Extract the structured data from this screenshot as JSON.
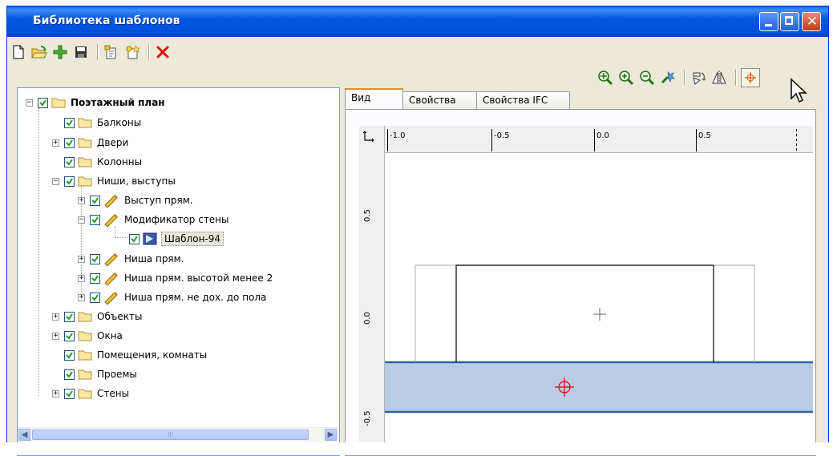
{
  "window": {
    "title": "Библиотека шаблонов"
  },
  "titlebar_buttons": {
    "minimize": "minimize-button",
    "maximize": "maximize-button",
    "close": "close-button"
  },
  "toolbar": {
    "left_icons": [
      "new-icon",
      "open-icon",
      "add-icon",
      "save-icon",
      "copy-icon",
      "paste-icon",
      "delete-icon"
    ],
    "right_icons": [
      "zoom-fit-icon",
      "zoom-in-icon",
      "zoom-out-icon",
      "zoom-pan-icon",
      "rotate-icon",
      "mirror-icon",
      "insertion-point-icon"
    ]
  },
  "tree": {
    "root": "Поэтажный план",
    "items": [
      {
        "label": "Балконы"
      },
      {
        "label": "Двери"
      },
      {
        "label": "Колонны"
      },
      {
        "label": "Ниши, выступы"
      },
      {
        "label": "Выступ прям."
      },
      {
        "label": "Модификатор стены"
      },
      {
        "label": "Шаблон-94"
      },
      {
        "label": "Ниша прям."
      },
      {
        "label": "Ниша прям. высотой менее 2"
      },
      {
        "label": "Ниша прям. не дох. до пола"
      },
      {
        "label": "Объекты"
      },
      {
        "label": "Окна"
      },
      {
        "label": "Помещения, комнаты"
      },
      {
        "label": "Проемы"
      },
      {
        "label": "Стены"
      }
    ],
    "scroll_thumb_label": "III"
  },
  "tabs": [
    {
      "label": "Вид"
    },
    {
      "label": "Свойства"
    },
    {
      "label": "Свойства IFC"
    }
  ],
  "view": {
    "x_ticks": [
      "-1.0",
      "-0.5",
      "0.0",
      "0.5"
    ],
    "y_ticks": [
      "0.5",
      "0.0",
      "-0.5"
    ],
    "axis_label": "y x",
    "wall_color": "#b8cde4",
    "wall_line_color": "#2e62a3",
    "marker_color": "#e00000"
  }
}
